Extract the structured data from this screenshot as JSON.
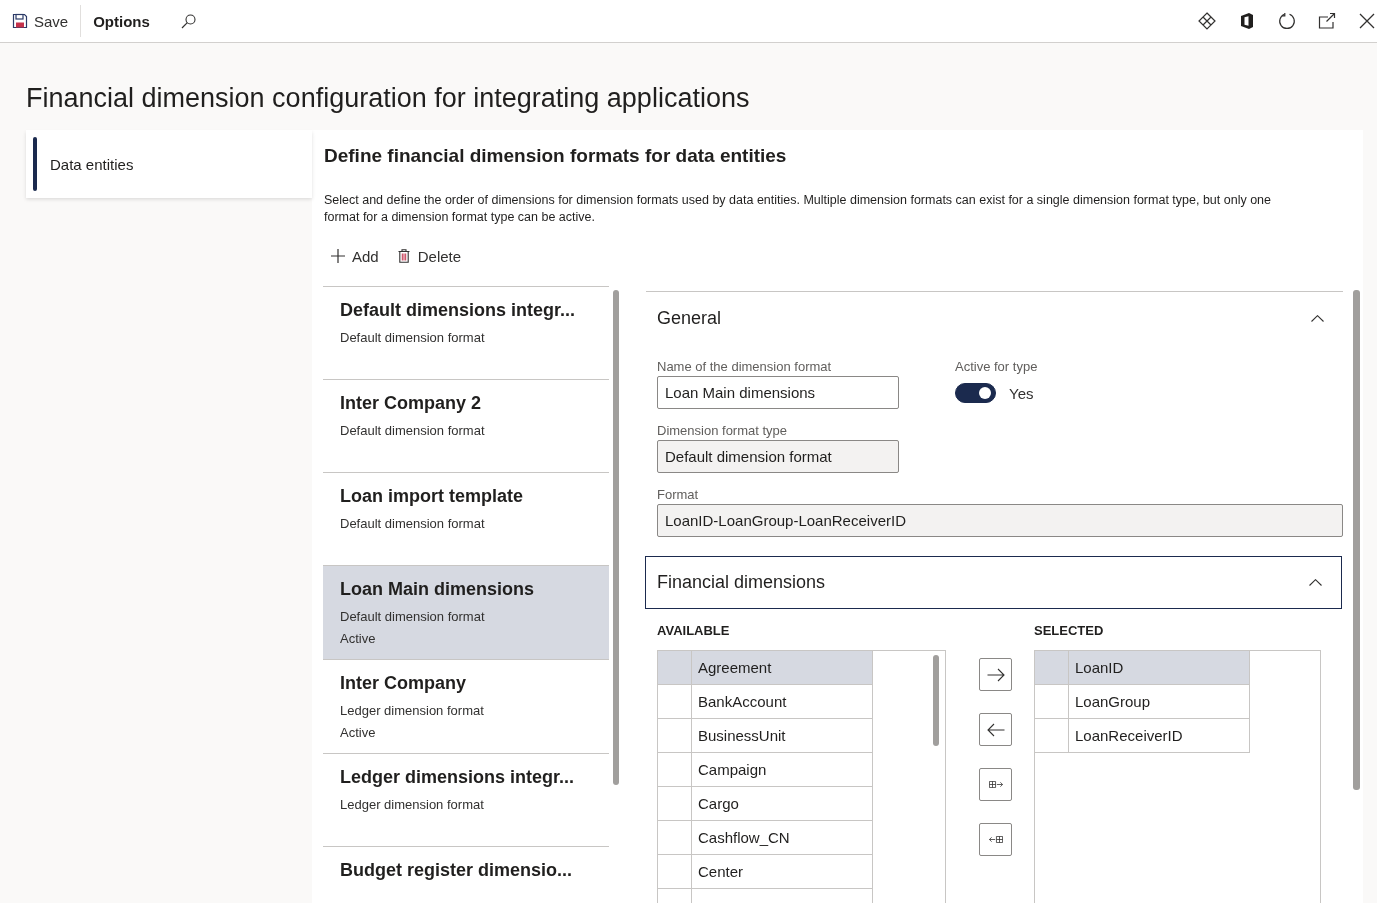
{
  "command_bar": {
    "save_label": "Save",
    "options_label": "Options"
  },
  "page_title": "Financial dimension configuration for integrating applications",
  "nav": {
    "items": [
      {
        "label": "Data entities",
        "selected": true
      }
    ]
  },
  "section": {
    "title": "Define financial dimension formats for data entities",
    "description": "Select and define the order of dimensions for dimension formats used by data entities. Multiple dimension formats can exist for a single dimension format type, but only one format for a dimension format type can be active.",
    "actions": [
      {
        "kind": "add",
        "label": "Add"
      },
      {
        "kind": "delete",
        "label": "Delete"
      }
    ]
  },
  "formats": [
    {
      "title": "Default dimensions integr...",
      "type": "Default dimension format",
      "selected": false
    },
    {
      "title": "Inter Company 2",
      "type": "Default dimension format",
      "selected": false
    },
    {
      "title": "Loan import template",
      "type": "Default dimension format",
      "selected": false
    },
    {
      "title": "Loan Main dimensions",
      "type": "Default dimension format",
      "status": "Active",
      "selected": true
    },
    {
      "title": "Inter Company",
      "type": "Ledger dimension format",
      "status": "Active",
      "selected": false
    },
    {
      "title": "Ledger dimensions integr...",
      "type": "Ledger dimension format",
      "selected": false
    },
    {
      "title": "Budget register dimensio...",
      "selected": false
    }
  ],
  "general": {
    "title": "General",
    "expanded": true,
    "name_field": {
      "label": "Name of the dimension format",
      "value": "Loan Main dimensions",
      "readonly": false
    },
    "active_toggle": {
      "label": "Active for type",
      "on": true,
      "value_text": "Yes"
    },
    "type_field": {
      "label": "Dimension format type",
      "value": "Default dimension format",
      "readonly": true
    },
    "format_field": {
      "label": "Format",
      "value": "LoanID-LoanGroup-LoanReceiverID",
      "readonly": true
    }
  },
  "financial_dimensions": {
    "title": "Financial dimensions",
    "expanded": true,
    "focused": true,
    "available_list": {
      "heading": "AVAILABLE",
      "rows": [
        {
          "label": "Agreement",
          "selected": true
        },
        {
          "label": "BankAccount",
          "selected": false
        },
        {
          "label": "BusinessUnit",
          "selected": false
        },
        {
          "label": "Campaign",
          "selected": false
        },
        {
          "label": "Cargo",
          "selected": false
        },
        {
          "label": "Cashflow_CN",
          "selected": false
        },
        {
          "label": "Center",
          "selected": false
        }
      ]
    },
    "selected_list": {
      "heading": "SELECTED",
      "rows": [
        {
          "label": "LoanID",
          "selected": true
        },
        {
          "label": "LoanGroup",
          "selected": false
        },
        {
          "label": "LoanReceiverID",
          "selected": false
        }
      ]
    }
  }
}
